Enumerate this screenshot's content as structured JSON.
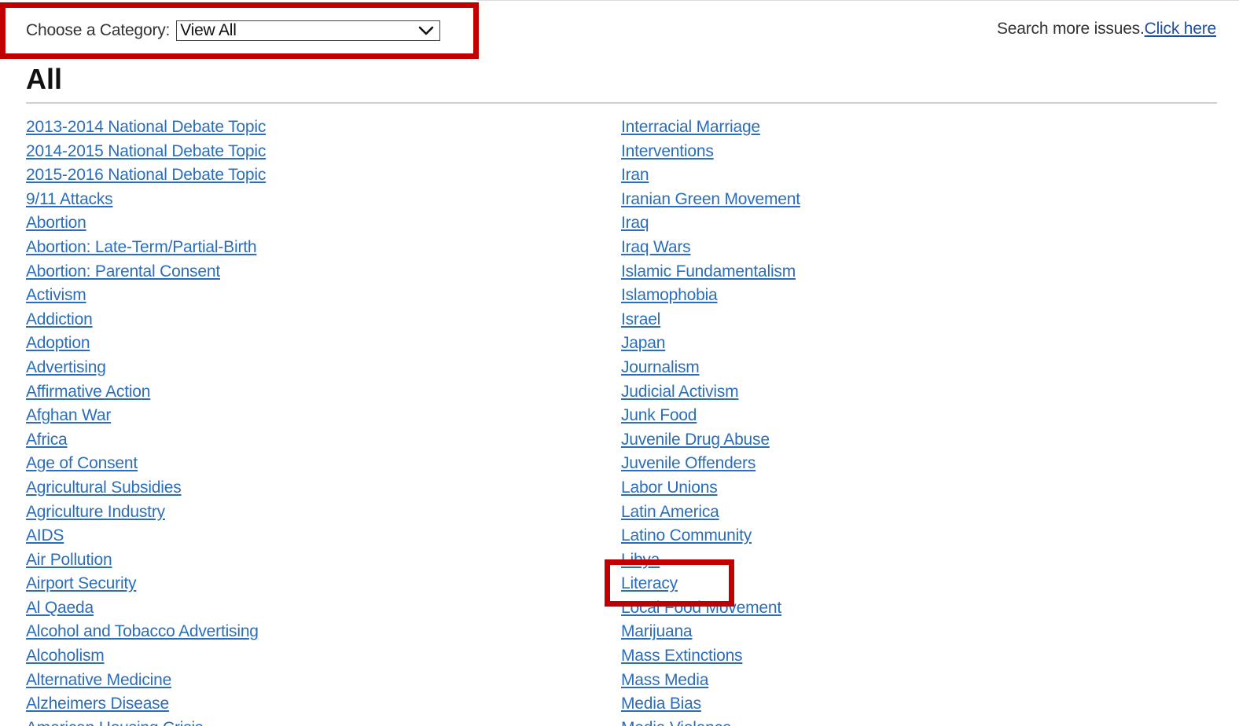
{
  "category_filter": {
    "label": "Choose a Category:",
    "selected": "View All"
  },
  "search_more": {
    "text": "Search more issues.",
    "link": "Click here"
  },
  "heading": "All",
  "colors": {
    "link": "#2a6ebb",
    "highlight": "#c00000"
  },
  "topics_left": [
    "2013-2014 National Debate Topic",
    "2014-2015 National Debate Topic",
    "2015-2016 National Debate Topic",
    "9/11 Attacks",
    "Abortion",
    "Abortion: Late-Term/Partial-Birth",
    "Abortion: Parental Consent",
    "Activism",
    "Addiction",
    "Adoption",
    "Advertising",
    "Affirmative Action",
    "Afghan War",
    "Africa",
    "Age of Consent",
    "Agricultural Subsidies",
    "Agriculture Industry",
    "AIDS",
    "Air Pollution",
    "Airport Security",
    "Al Qaeda",
    "Alcohol and Tobacco Advertising",
    "Alcoholism",
    "Alternative Medicine",
    "Alzheimers Disease",
    "American Housing Crisis"
  ],
  "topics_right": [
    "Interracial Marriage",
    "Interventions",
    "Iran",
    "Iranian Green Movement",
    "Iraq",
    "Iraq Wars",
    "Islamic Fundamentalism",
    "Islamophobia",
    "Israel",
    "Japan",
    "Journalism",
    "Judicial Activism",
    "Junk Food",
    "Juvenile Drug Abuse",
    "Juvenile Offenders",
    "Labor Unions",
    "Latin America",
    "Latino Community",
    "Libya",
    "Literacy",
    "Local Food Movement",
    "Marijuana",
    "Mass Extinctions",
    "Mass Media",
    "Media Bias",
    "Media Violence"
  ]
}
